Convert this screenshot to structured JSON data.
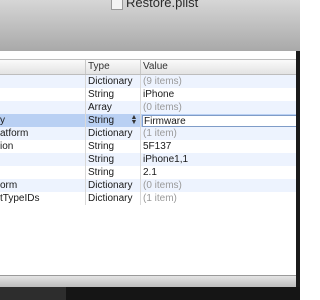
{
  "window": {
    "title": "Restore.plist"
  },
  "table": {
    "columns": [
      "",
      "Type",
      "Value"
    ],
    "rows": [
      {
        "key": "",
        "type": "Dictionary",
        "value": "(9 items)",
        "value_muted": true
      },
      {
        "key": "",
        "type": "String",
        "value": "iPhone",
        "value_muted": false
      },
      {
        "key": "",
        "type": "Array",
        "value": "(0 items)",
        "value_muted": true
      },
      {
        "key": "y",
        "type": "String",
        "value": "Firmware",
        "value_muted": false,
        "selected": true
      },
      {
        "key": "atform",
        "type": "Dictionary",
        "value": "(1 item)",
        "value_muted": true
      },
      {
        "key": "ion",
        "type": "String",
        "value": "5F137",
        "value_muted": false
      },
      {
        "key": "",
        "type": "String",
        "value": "iPhone1,1",
        "value_muted": false
      },
      {
        "key": "",
        "type": "String",
        "value": "2.1",
        "value_muted": false
      },
      {
        "key": "orm",
        "type": "Dictionary",
        "value": "(0 items)",
        "value_muted": true
      },
      {
        "key": "tTypeIDs",
        "type": "Dictionary",
        "value": "(1 item)",
        "value_muted": true
      }
    ]
  },
  "colors": {
    "selection": "#b9d0f3",
    "alt_row": "#edf3fe",
    "muted_text": "#9a9a9a"
  }
}
